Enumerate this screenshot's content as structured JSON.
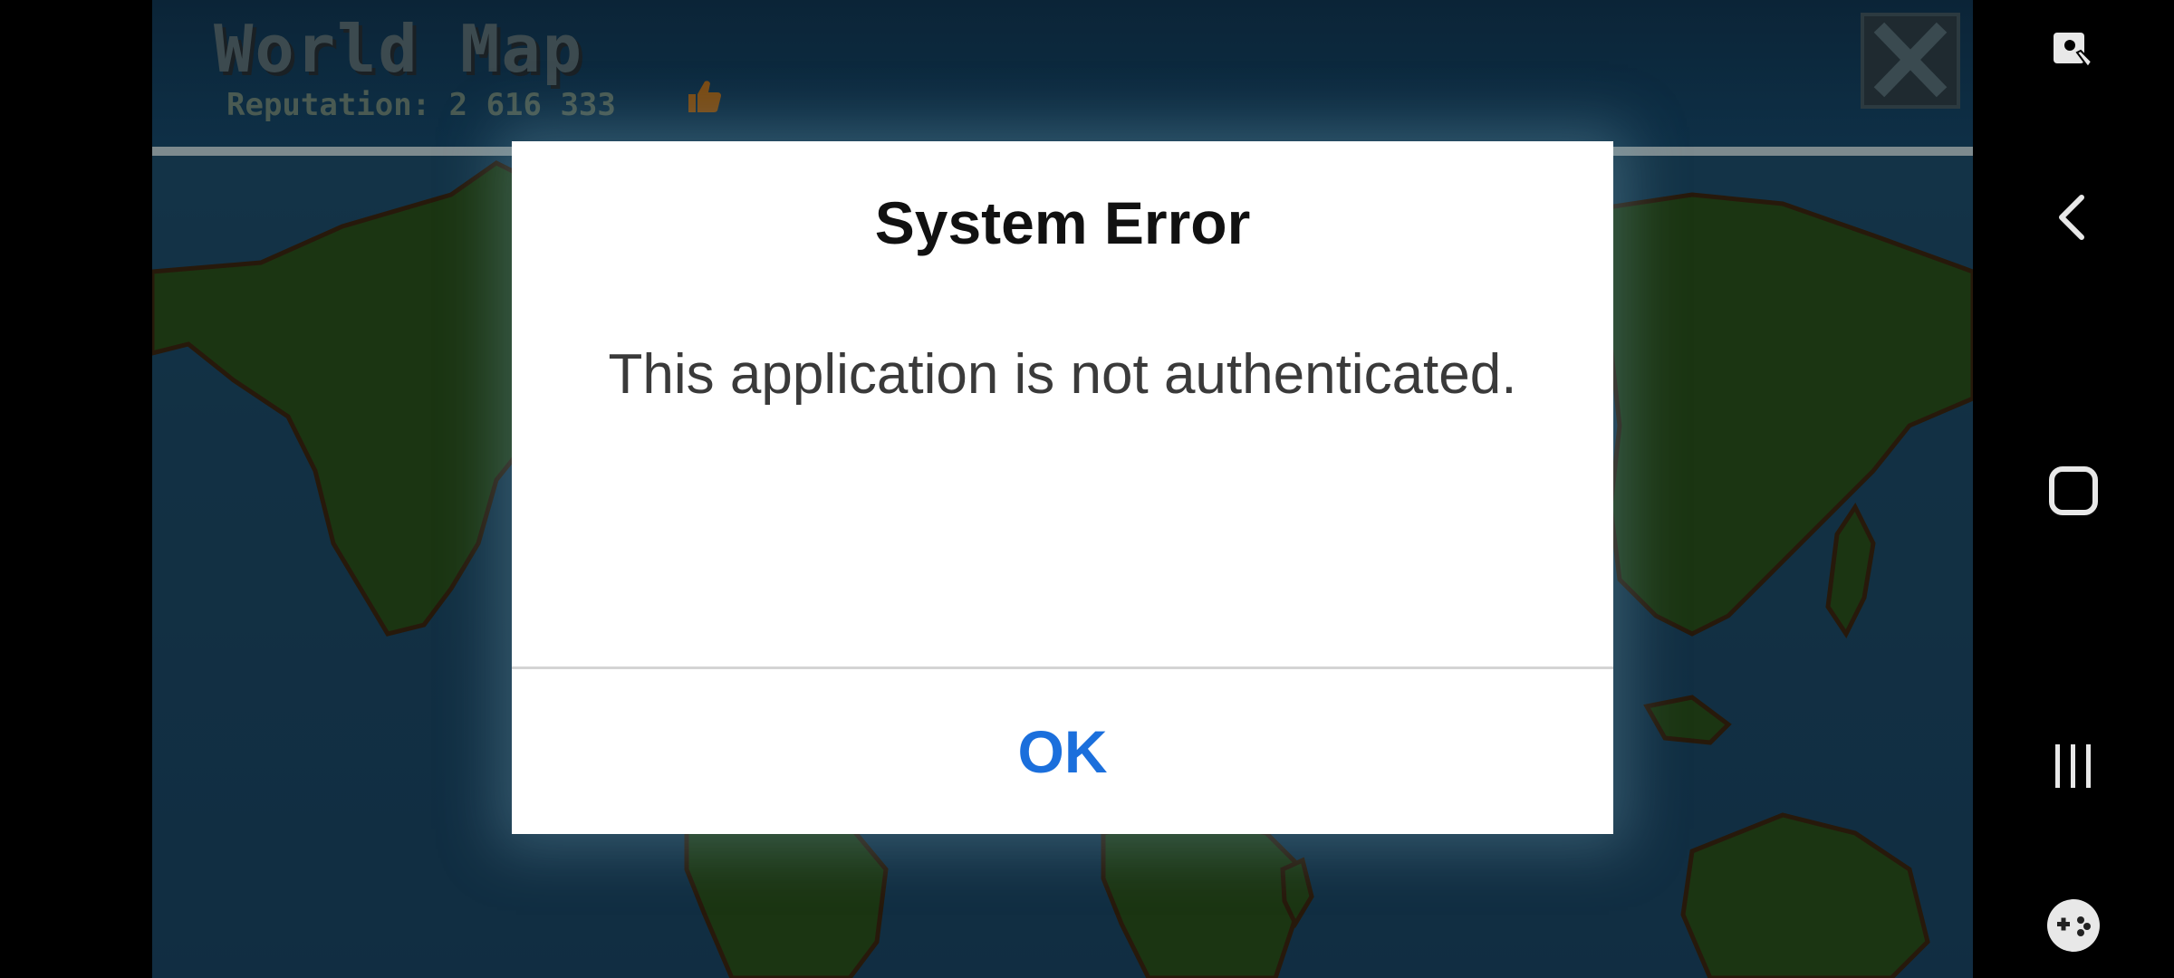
{
  "game": {
    "title": "World Map",
    "reputation": "Reputation: 2 616 333",
    "reputation_icon": "thumbs-up-icon",
    "close_icon": "close-icon"
  },
  "dialog": {
    "title": "System Error",
    "message": "This application is not authenticated.",
    "ok_label": "OK",
    "ok_color": "#1b6fdc"
  },
  "navbar": {
    "items": [
      {
        "name": "screen-pin-icon"
      },
      {
        "name": "back-icon"
      },
      {
        "name": "home-icon"
      },
      {
        "name": "recents-icon"
      },
      {
        "name": "game-tools-icon"
      }
    ]
  },
  "colors": {
    "ocean": "#2a6f9b",
    "land": "#3f7a2a",
    "dialog_bg": "#ffffff"
  }
}
